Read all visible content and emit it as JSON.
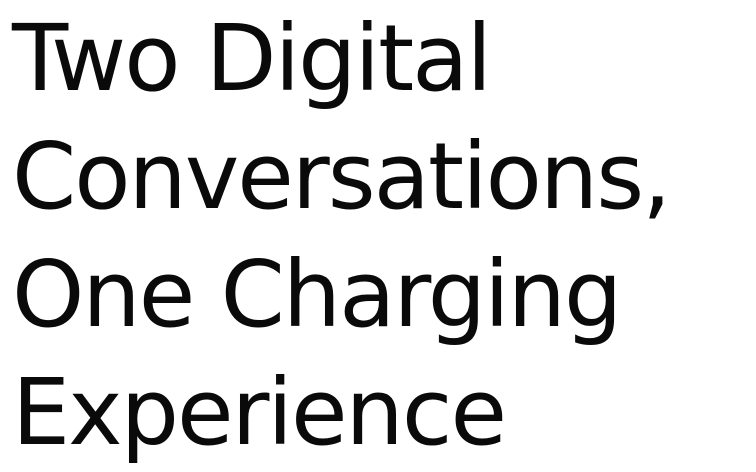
{
  "headline": {
    "lines": [
      "Two Digital",
      "Conversations,",
      "One Charging",
      "Experience"
    ]
  },
  "colors": {
    "background": "#ffffff",
    "text": "#0a0a0a"
  }
}
